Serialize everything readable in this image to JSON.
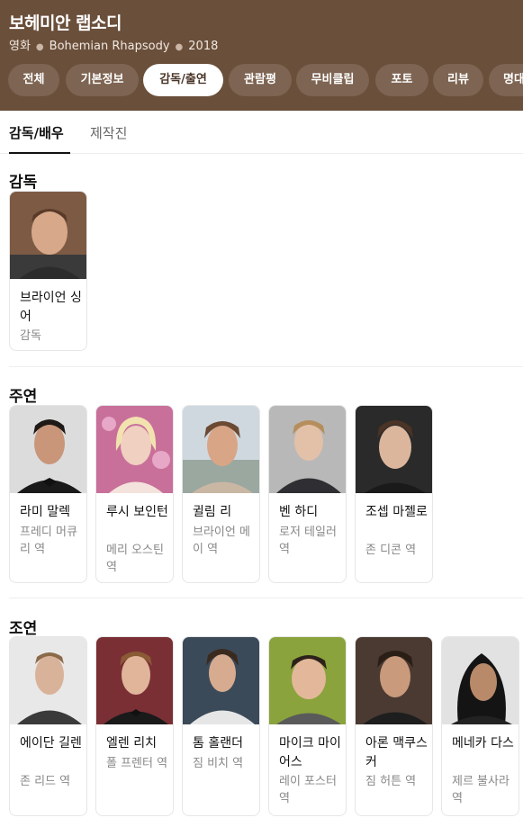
{
  "header": {
    "title": "보헤미안 랩소디",
    "meta": [
      "영화",
      "Bohemian Rhapsody",
      "2018"
    ]
  },
  "tabs": [
    "전체",
    "기본정보",
    "감독/출연",
    "관람평",
    "무비클립",
    "포토",
    "리뷰",
    "명대"
  ],
  "active_tab": "감독/출연",
  "subtabs": [
    "감독/배우",
    "제작진"
  ],
  "sections": [
    {
      "title": "감독",
      "people": [
        {
          "name": "브라이언 싱어",
          "role": "감독"
        }
      ]
    },
    {
      "title": "주연",
      "people": [
        {
          "name": "라미 말렉",
          "role": "프레디 머큐리 역"
        },
        {
          "name": "루시 보인턴",
          "role": "메리 오스틴 역"
        },
        {
          "name": "귈림 리",
          "role": "브라이언 메이 역"
        },
        {
          "name": "벤 하디",
          "role": "로저 테일러 역"
        },
        {
          "name": "조셉 마젤로",
          "role": "존 디콘 역"
        }
      ]
    },
    {
      "title": "조연",
      "people": [
        {
          "name": "에이단 길렌",
          "role": "존 리드 역"
        },
        {
          "name": "엘렌 리치",
          "role": "폴 프렌터 역"
        },
        {
          "name": "톰 홀랜더",
          "role": "짐 비치 역"
        },
        {
          "name": "마이크 마이어스",
          "role": "레이 포스터 역"
        },
        {
          "name": "아론 맥쿠스커",
          "role": "짐 허튼 역"
        },
        {
          "name": "메네카 다스",
          "role": "제르 불사라 역"
        }
      ]
    }
  ],
  "colors": {
    "header_bg": "#6a4f3b",
    "tab_bg": "#7e6452",
    "tab_active_bg": "#ffffff"
  }
}
